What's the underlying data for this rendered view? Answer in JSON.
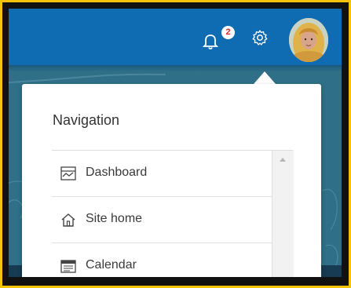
{
  "header": {
    "notifications": {
      "count": "2",
      "icon": "bell-icon"
    },
    "settings": {
      "icon": "gear-icon"
    },
    "user_avatar": {
      "icon": "avatar"
    }
  },
  "navigation": {
    "title": "Navigation",
    "items": [
      {
        "label": "Dashboard",
        "icon": "dashboard-icon"
      },
      {
        "label": "Site home",
        "icon": "home-icon"
      },
      {
        "label": "Calendar",
        "icon": "calendar-icon"
      }
    ]
  },
  "colors": {
    "header_blue": "#0f6cb3",
    "frame_yellow": "#f6c20a",
    "badge_red": "#e0242b"
  }
}
